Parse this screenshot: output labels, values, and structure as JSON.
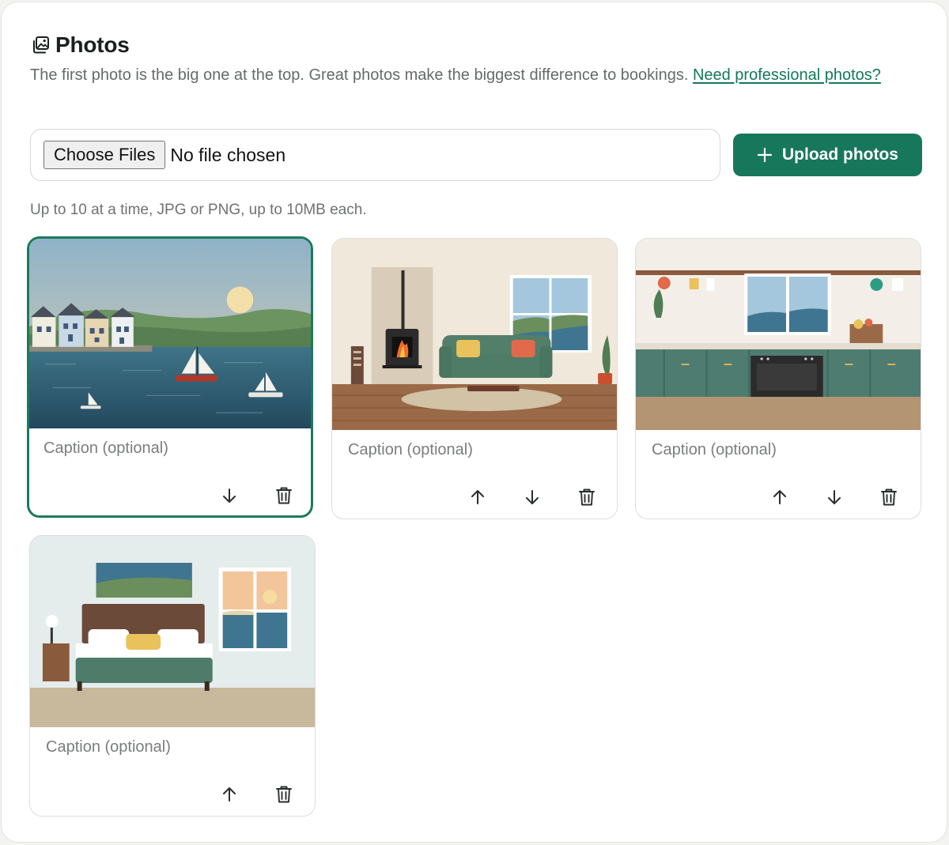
{
  "section": {
    "title": "Photos",
    "description": "The first photo is the big one at the top. Great photos make the biggest difference to bookings.",
    "link_text": "Need professional photos?",
    "icon": "photos-icon"
  },
  "file_input": {
    "button_label": "Choose Files",
    "status": "No file chosen"
  },
  "upload_button": {
    "label": "Upload photos",
    "icon": "plus-icon"
  },
  "hint": "Up to 10 at a time, JPG or PNG, up to 10MB each.",
  "photos": [
    {
      "scene": "harbour",
      "caption_placeholder": "Caption (optional)",
      "actions": [
        "move-down",
        "delete"
      ],
      "selected": true
    },
    {
      "scene": "living-room",
      "caption_placeholder": "Caption (optional)",
      "actions": [
        "move-up",
        "move-down",
        "delete"
      ],
      "selected": false
    },
    {
      "scene": "kitchen",
      "caption_placeholder": "Caption (optional)",
      "actions": [
        "move-up",
        "move-down",
        "delete"
      ],
      "selected": false
    },
    {
      "scene": "bedroom",
      "caption_placeholder": "Caption (optional)",
      "actions": [
        "move-up",
        "delete"
      ],
      "selected": false
    }
  ],
  "colors": {
    "accent": "#17775a",
    "link": "#13795b",
    "selected_border": "#1b7a5c"
  }
}
